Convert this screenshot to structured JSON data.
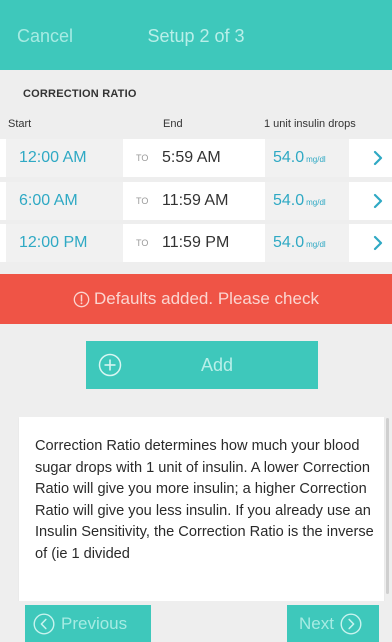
{
  "header": {
    "cancel_label": "Cancel",
    "title": "Setup 2 of 3"
  },
  "section": {
    "title": "CORRECTION RATIO",
    "columns": {
      "start": "Start",
      "end": "End",
      "drops": "1 unit insulin drops"
    }
  },
  "rows": [
    {
      "start": "12:00 AM",
      "to": "TO",
      "end": "5:59 AM",
      "value": "54.0",
      "unit": "mg/dl"
    },
    {
      "start": "6:00 AM",
      "to": "TO",
      "end": "11:59 AM",
      "value": "54.0",
      "unit": "mg/dl"
    },
    {
      "start": "12:00 PM",
      "to": "TO",
      "end": "11:59 PM",
      "value": "54.0",
      "unit": "mg/dl"
    }
  ],
  "alert": {
    "message": "Defaults added. Please check"
  },
  "add_button": {
    "label": "Add"
  },
  "info": {
    "text": "Correction Ratio determines how much your blood sugar drops with 1 unit of insulin. A lower Correction Ratio will give you more insulin; a higher Correction Ratio will give you less insulin. If you already use an Insulin Sensitivity, the Correction Ratio is the inverse of (ie 1 divided"
  },
  "footer": {
    "previous_label": "Previous",
    "next_label": "Next"
  },
  "icons": {
    "row_action": "chevron-right-icon",
    "alert": "alert-circle-icon",
    "add": "plus-circle-icon",
    "previous": "chevron-left-circle-icon",
    "next": "chevron-right-circle-icon"
  },
  "colors": {
    "accent": "#3ec8bb",
    "link": "#2fa9c4",
    "alert": "#ef5446",
    "background": "#eeeeee"
  }
}
